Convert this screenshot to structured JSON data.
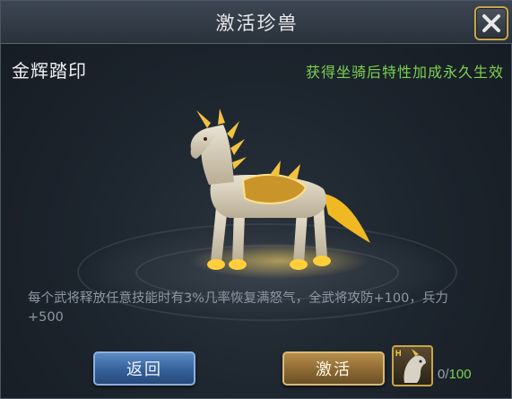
{
  "window": {
    "title": "激活珍兽",
    "close_icon": "close-x-icon"
  },
  "mount": {
    "name": "金辉踏印",
    "hint": "获得坐骑后特性加成永久生效",
    "image_icon": "golden-horse-mount-icon",
    "description": "每个武将释放任意技能时有3%几率恢复满怒气，全武将攻防+100，兵力+500"
  },
  "buttons": {
    "back_label": "返回",
    "activate_label": "激活"
  },
  "material": {
    "icon": "horse-token-icon",
    "badge": "H",
    "have": "0",
    "separator": "/",
    "need": "100"
  },
  "colors": {
    "hint": "#7bd24f",
    "need_count": "#7bd24f",
    "back_button": "#34609a",
    "activate_button": "#8c6a33",
    "gold_border": "#c9a44a"
  }
}
